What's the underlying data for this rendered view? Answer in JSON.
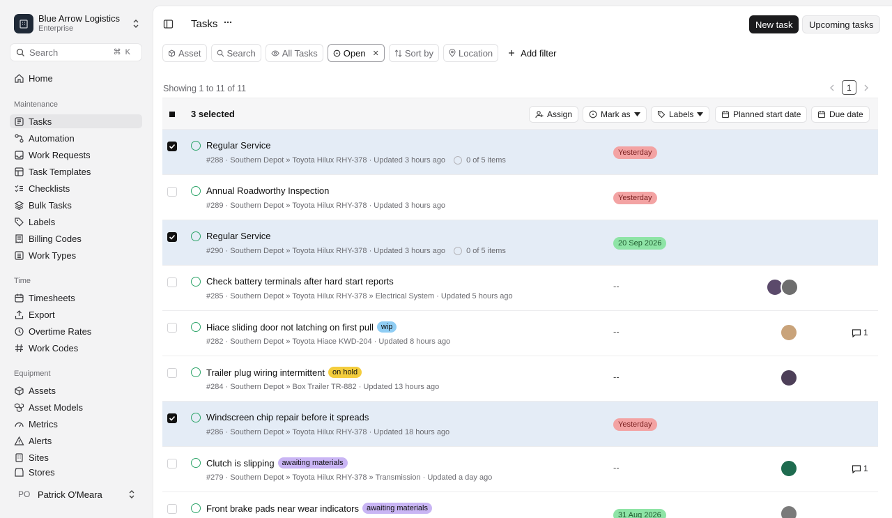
{
  "sidebar": {
    "org": {
      "name": "Blue Arrow Logistics",
      "plan": "Enterprise"
    },
    "search": {
      "label": "Search",
      "shortcut": "⌘K"
    },
    "home": "Home",
    "sections": [
      {
        "label": "Maintenance",
        "items": [
          "Tasks",
          "Automation",
          "Work Requests",
          "Task Templates",
          "Checklists",
          "Bulk Tasks",
          "Labels",
          "Billing Codes",
          "Work Types"
        ]
      },
      {
        "label": "Time",
        "items": [
          "Timesheets",
          "Export",
          "Overtime Rates",
          "Work Codes"
        ]
      },
      {
        "label": "Equipment",
        "items": [
          "Assets",
          "Asset Models",
          "Metrics",
          "Alerts",
          "Sites",
          "Stores"
        ]
      }
    ],
    "user": {
      "initials": "PO",
      "name": "Patrick O'Meara"
    }
  },
  "header": {
    "title": "Tasks",
    "new_task": "New task",
    "upcoming": "Upcoming tasks"
  },
  "filters": {
    "asset": "Asset",
    "search": "Search",
    "all_tasks": "All Tasks",
    "open": "Open",
    "sort_by": "Sort by",
    "location": "Location",
    "add_filter": "Add filter"
  },
  "listing": {
    "showing": "Showing 1 to 11 of 11",
    "page": "1"
  },
  "selection": {
    "count_label": "3 selected",
    "assign": "Assign",
    "mark_as": "Mark as",
    "labels": "Labels",
    "planned_start": "Planned start date",
    "due_date": "Due date"
  },
  "colors": {
    "selected_row": "#e4ecf6",
    "status_green": "#2ea56a",
    "pill_red": "#f3a3a3",
    "pill_green": "#8ee4a6",
    "tag_blue": "#8fcdf4",
    "tag_yellow": "#f4cd3d",
    "tag_purple": "#c9b5f4"
  },
  "rows": [
    {
      "title": "Regular Service",
      "id": "#288",
      "site": "Southern Depot",
      "path": "Toyota Hilux RHY-378",
      "updated": "Updated 3 hours ago",
      "items": "0 of 5 items",
      "date": "Yesterday",
      "date_kind": "red",
      "checked": true
    },
    {
      "title": "Annual Roadworthy Inspection",
      "id": "#289",
      "site": "Southern Depot",
      "path": "Toyota Hilux RHY-378",
      "updated": "Updated 3 hours ago",
      "date": "Yesterday",
      "date_kind": "red",
      "checked": false
    },
    {
      "title": "Regular Service",
      "id": "#290",
      "site": "Southern Depot",
      "path": "Toyota Hilux RHY-378",
      "updated": "Updated 3 hours ago",
      "items": "0 of 5 items",
      "date": "20 Sep 2026",
      "date_kind": "green",
      "checked": true
    },
    {
      "title": "Check battery terminals after hard start reports",
      "id": "#285",
      "site": "Southern Depot",
      "path": "Toyota Hilux RHY-378 » Electrical System",
      "updated": "Updated 5 hours ago",
      "date": "--",
      "date_kind": "none",
      "checked": false,
      "avatars": 2
    },
    {
      "title": "Hiace sliding door not latching on first pull",
      "tag": "wip",
      "tag_kind": "blue",
      "id": "#282",
      "site": "Southern Depot",
      "path": "Toyota Hiace KWD-204",
      "updated": "Updated 8 hours ago",
      "date": "--",
      "date_kind": "none",
      "checked": false,
      "avatars": 1,
      "comments": "1"
    },
    {
      "title": "Trailer plug wiring intermittent",
      "tag": "on hold",
      "tag_kind": "yellow",
      "id": "#284",
      "site": "Southern Depot",
      "path": "Box Trailer TR-882",
      "updated": "Updated 13 hours ago",
      "date": "--",
      "date_kind": "none",
      "checked": false,
      "avatars": 1
    },
    {
      "title": "Windscreen chip repair before it spreads",
      "id": "#286",
      "site": "Southern Depot",
      "path": "Toyota Hilux RHY-378",
      "updated": "Updated 18 hours ago",
      "date": "Yesterday",
      "date_kind": "red",
      "checked": true
    },
    {
      "title": "Clutch is slipping",
      "tag": "awaiting materials",
      "tag_kind": "purple",
      "id": "#279",
      "site": "Southern Depot",
      "path": "Toyota Hilux RHY-378 » Transmission",
      "updated": "Updated a day ago",
      "date": "--",
      "date_kind": "none",
      "checked": false,
      "avatars": 1,
      "comments": "1"
    },
    {
      "title": "Front brake pads near wear indicators",
      "tag": "awaiting materials",
      "tag_kind": "purple",
      "date": "31 Aug 2026",
      "date_kind": "green",
      "checked": false,
      "avatars": 1
    }
  ]
}
